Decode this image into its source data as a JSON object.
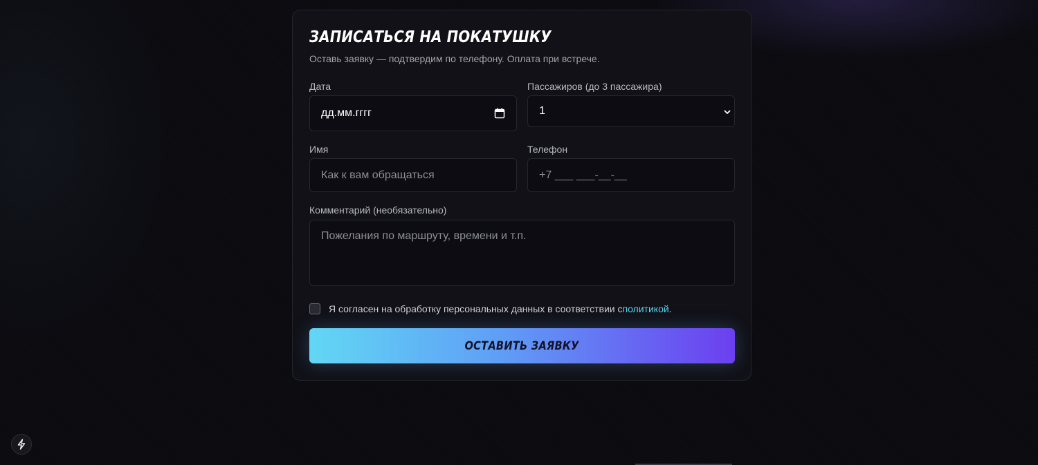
{
  "form": {
    "title": "ЗАПИСАТЬСЯ НА ПОКАТУШКУ",
    "subtitle": "Оставь заявку — подтвердим по телефону. Оплата при встрече.",
    "date": {
      "label": "Дата",
      "value": "дд.мм.гггг"
    },
    "passengers": {
      "label": "Пассажиров (до 3 пассажира)",
      "value": "1"
    },
    "name": {
      "label": "Имя",
      "placeholder": "Как к вам обращаться"
    },
    "phone": {
      "label": "Телефон",
      "placeholder": "+7 ___ ___-__-__"
    },
    "comment": {
      "label": "Комментарий (необязательно)",
      "placeholder": "Пожелания по маршруту, времени и т.п."
    },
    "consent": {
      "text": "Я согласен на обработку персональных данных в соответствии с ",
      "link": "политикой",
      "end": ".",
      "checked": false
    },
    "submit_label": "ОСТАВИТЬ ЗАЯВКУ"
  },
  "icons": {
    "date": "calendar-icon",
    "select": "chevron-down-icon",
    "fab": "bolt-icon"
  },
  "colors": {
    "accent_start": "#62d7f4",
    "accent_end": "#6c3ff0",
    "link": "#5fd3ec"
  }
}
